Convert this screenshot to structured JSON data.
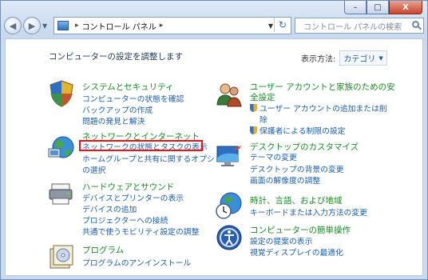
{
  "window": {
    "buttons": {
      "minimize": "–",
      "maximize": "□",
      "close": "X"
    }
  },
  "nav": {
    "back_icon": "back-arrow-icon",
    "forward_icon": "forward-arrow-icon",
    "breadcrumb": [
      "コントロール パネル"
    ],
    "search_placeholder": "コントロール パネルの検索"
  },
  "page": {
    "heading": "コンピューターの設定を調整します",
    "view_by_label": "表示方法:",
    "view_by_value": "カテゴリ"
  },
  "categories_left": [
    {
      "title": "システムとセキュリティ",
      "links": [
        "コンピューターの状態を確認",
        "バックアップの作成",
        "問題の発見と解決"
      ]
    },
    {
      "title": "ネットワークとインターネット",
      "links": [
        "ネットワークの状態とタスクの表示",
        "ホームグループと共有に関するオプション",
        "の選択"
      ]
    },
    {
      "title": "ハードウェアとサウンド",
      "links": [
        "デバイスとプリンターの表示",
        "デバイスの追加",
        "プロジェクターへの接続",
        "共通で使うモビリティ設定の調整"
      ]
    },
    {
      "title": "プログラム",
      "links": [
        "プログラムのアンインストール"
      ]
    }
  ],
  "categories_right": [
    {
      "title": "ユーザー アカウントと家族のための安",
      "title2": "全設定",
      "links": [
        "ユーザー アカウントの追加または削",
        "除",
        "保護者による制限の設定"
      ]
    },
    {
      "title": "デスクトップのカスタマイズ",
      "links": [
        "テーマの変更",
        "デスクトップの背景の変更",
        "画面の解像度の調整"
      ]
    },
    {
      "title": "時計、言語、および地域",
      "links": [
        "キーボードまたは入力方法の変更"
      ]
    },
    {
      "title": "コンピューターの簡単操作",
      "links": [
        "設定の提案の表示",
        "視覚ディスプレイの最適化"
      ]
    }
  ],
  "highlight_color": "#e8141b",
  "link_color": "#1f5fa8",
  "title_color": "#1a8a24"
}
